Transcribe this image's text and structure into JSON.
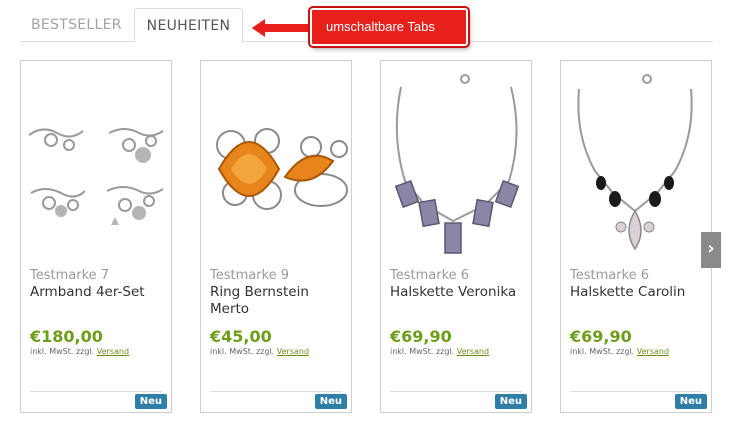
{
  "tabs": {
    "bestseller": "BESTSELLER",
    "neuheiten": "NEUHEITEN"
  },
  "annotation": {
    "label": "umschaltbare Tabs",
    "color": "#e8201c"
  },
  "colors": {
    "price": "#6d9d1b",
    "badge": "#2e7ea8",
    "link": "#6d8f1b"
  },
  "products": [
    {
      "brand": "Testmarke 7",
      "name": "Armband 4er-Set",
      "price": "€180,00",
      "vat_prefix": "inkl. MwSt. zzgl.",
      "shipping_link": "Versand",
      "badge": "Neu",
      "image_icon": "charm-bracelets-image"
    },
    {
      "brand": "Testmarke 9",
      "name": "Ring Bernstein Merto",
      "price": "€45,00",
      "vat_prefix": "inkl. MwSt. zzgl.",
      "shipping_link": "Versand",
      "badge": "Neu",
      "image_icon": "amber-ring-image"
    },
    {
      "brand": "Testmarke 6",
      "name": "Halskette Veronika",
      "price": "€69,90",
      "vat_prefix": "inkl. MwSt. zzgl.",
      "shipping_link": "Versand",
      "badge": "Neu",
      "image_icon": "fluorite-necklace-image"
    },
    {
      "brand": "Testmarke 6",
      "name": "Halskette Carolin",
      "price": "€69,90",
      "vat_prefix": "inkl. MwSt. zzgl.",
      "shipping_link": "Versand",
      "badge": "Neu",
      "image_icon": "onyx-necklace-image"
    }
  ],
  "carousel": {
    "next_icon": "chevron-right-icon",
    "next_glyph": "›"
  }
}
